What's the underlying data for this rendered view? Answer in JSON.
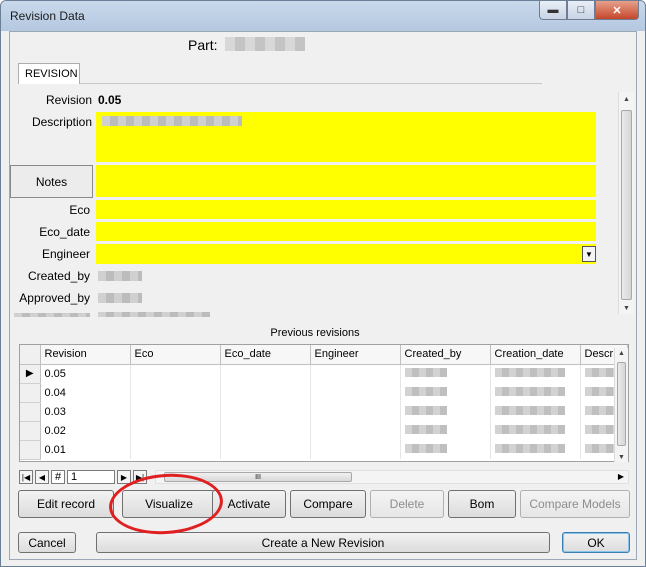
{
  "window": {
    "title": "Revision Data",
    "buttons": {
      "minimize": "▬",
      "maximize": "□",
      "close": "✕"
    }
  },
  "part": {
    "label": "Part:"
  },
  "tab": {
    "label": "REVISION"
  },
  "form": {
    "revision_label": "Revision",
    "revision_value": "0.05",
    "description_label": "Description",
    "notes_button": "Notes",
    "eco_label": "Eco",
    "eco_date_label": "Eco_date",
    "engineer_label": "Engineer",
    "created_by_label": "Created_by",
    "approved_by_label": "Approved_by",
    "field_color": "#ffff00"
  },
  "grid": {
    "title": "Previous revisions",
    "columns": [
      "Revision",
      "Eco",
      "Eco_date",
      "Engineer",
      "Created_by",
      "Creation_date",
      "Descrip"
    ],
    "rows": [
      {
        "revision": "0.05",
        "current": true
      },
      {
        "revision": "0.04",
        "current": false
      },
      {
        "revision": "0.03",
        "current": false
      },
      {
        "revision": "0.02",
        "current": false
      },
      {
        "revision": "0.01",
        "current": false
      }
    ],
    "record_position": "1"
  },
  "buttons": {
    "edit_record": "Edit record",
    "visualize": "Visualize",
    "activate": "Activate",
    "compare": "Compare",
    "delete": "Delete",
    "bom": "Bom",
    "compare_models": "Compare Models",
    "cancel": "Cancel",
    "create_revision": "Create a New Revision",
    "ok": "OK"
  },
  "highlight_color": "#e02020"
}
